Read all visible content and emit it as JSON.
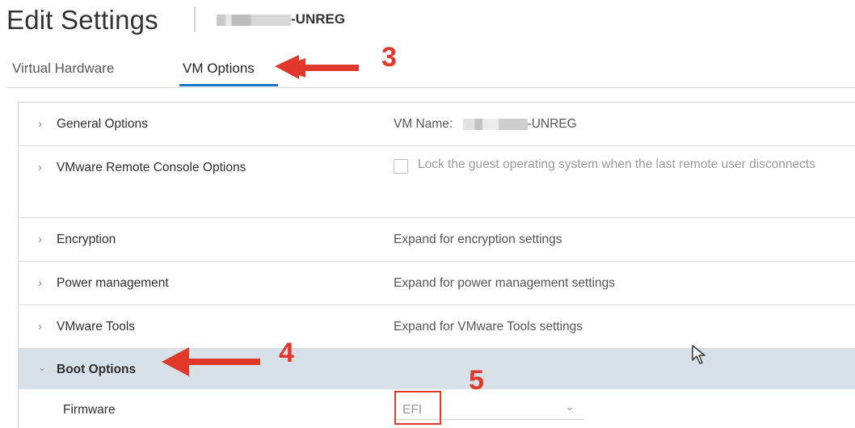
{
  "header": {
    "title": "Edit Settings",
    "vm_name_suffix": "-UNREG"
  },
  "tabs": [
    {
      "label": "Virtual Hardware",
      "active": false
    },
    {
      "label": "VM Options",
      "active": true
    }
  ],
  "sections": [
    {
      "label": "General Options",
      "value_label": "VM Name:",
      "value_suffix": "-UNREG",
      "expanded": false
    },
    {
      "label": "VMware Remote Console Options",
      "checkbox_label": "Lock the guest operating system when the last remote user disconnects",
      "checked": false,
      "expanded": false
    },
    {
      "label": "Encryption",
      "value": "Expand for encryption settings",
      "expanded": false
    },
    {
      "label": "Power management",
      "value": "Expand for power management settings",
      "expanded": false
    },
    {
      "label": "VMware Tools",
      "value": "Expand for VMware Tools settings",
      "expanded": false
    },
    {
      "label": "Boot Options",
      "expanded": true
    }
  ],
  "firmware": {
    "label": "Firmware",
    "selected": "EFI"
  },
  "annotations": {
    "step3": "3",
    "step4": "4",
    "step5": "5",
    "color": "#e0392b"
  },
  "icons": {
    "collapsed": "chevron-right-icon",
    "expanded": "chevron-down-icon",
    "cursor": "mouse-pointer-icon"
  }
}
